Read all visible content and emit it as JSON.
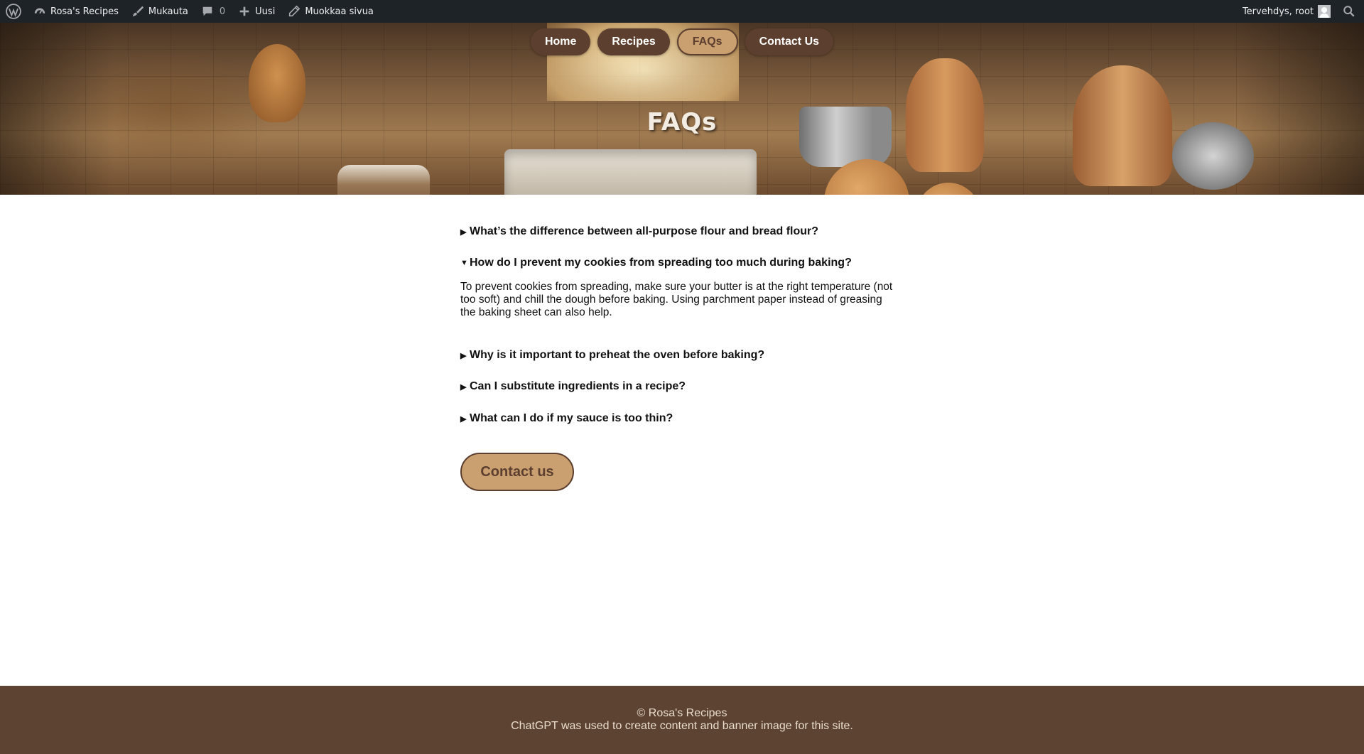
{
  "admin_bar": {
    "site_name": "Rosa's Recipes",
    "customize": "Mukauta",
    "comments_count": "0",
    "new": "Uusi",
    "edit_page": "Muokkaa sivua",
    "greeting": "Tervehdys, root",
    "icons": [
      "wordpress-logo-icon",
      "dashboard-icon",
      "brush-icon",
      "comment-icon",
      "plus-icon",
      "pencil-icon",
      "avatar-icon",
      "search-icon"
    ]
  },
  "nav": {
    "items": [
      {
        "label": "Home",
        "active": false
      },
      {
        "label": "Recipes",
        "active": false
      },
      {
        "label": "FAQs",
        "active": true
      },
      {
        "label": "Contact Us",
        "active": false
      }
    ]
  },
  "hero": {
    "title": "FAQs"
  },
  "faqs": [
    {
      "question": "What’s the difference between all-purpose flour and bread flour?",
      "open": false,
      "arrow": "▶"
    },
    {
      "question": "How do I prevent my cookies from spreading too much during baking?",
      "open": true,
      "arrow": "▼",
      "answer": "To prevent cookies from spreading, make sure your butter is at the right temperature (not too soft) and chill the dough before baking. Using parchment paper instead of greasing the baking sheet can also help."
    },
    {
      "question": "Why is it important to preheat the oven before baking?",
      "open": false,
      "arrow": "▶"
    },
    {
      "question": "Can I substitute ingredients in a recipe?",
      "open": false,
      "arrow": "▶"
    },
    {
      "question": "What can I do if my sauce is too thin?",
      "open": false,
      "arrow": "▶"
    }
  ],
  "contact_button": "Contact us",
  "footer": {
    "copyright": "© Rosa's Recipes",
    "note": "ChatGPT was used to create content and banner image for this site."
  },
  "colors": {
    "admin_bar_bg": "#1d2327",
    "nav_bg": "#5c3f2e",
    "nav_active_bg": "#caa071",
    "footer_bg": "#5c4332"
  }
}
